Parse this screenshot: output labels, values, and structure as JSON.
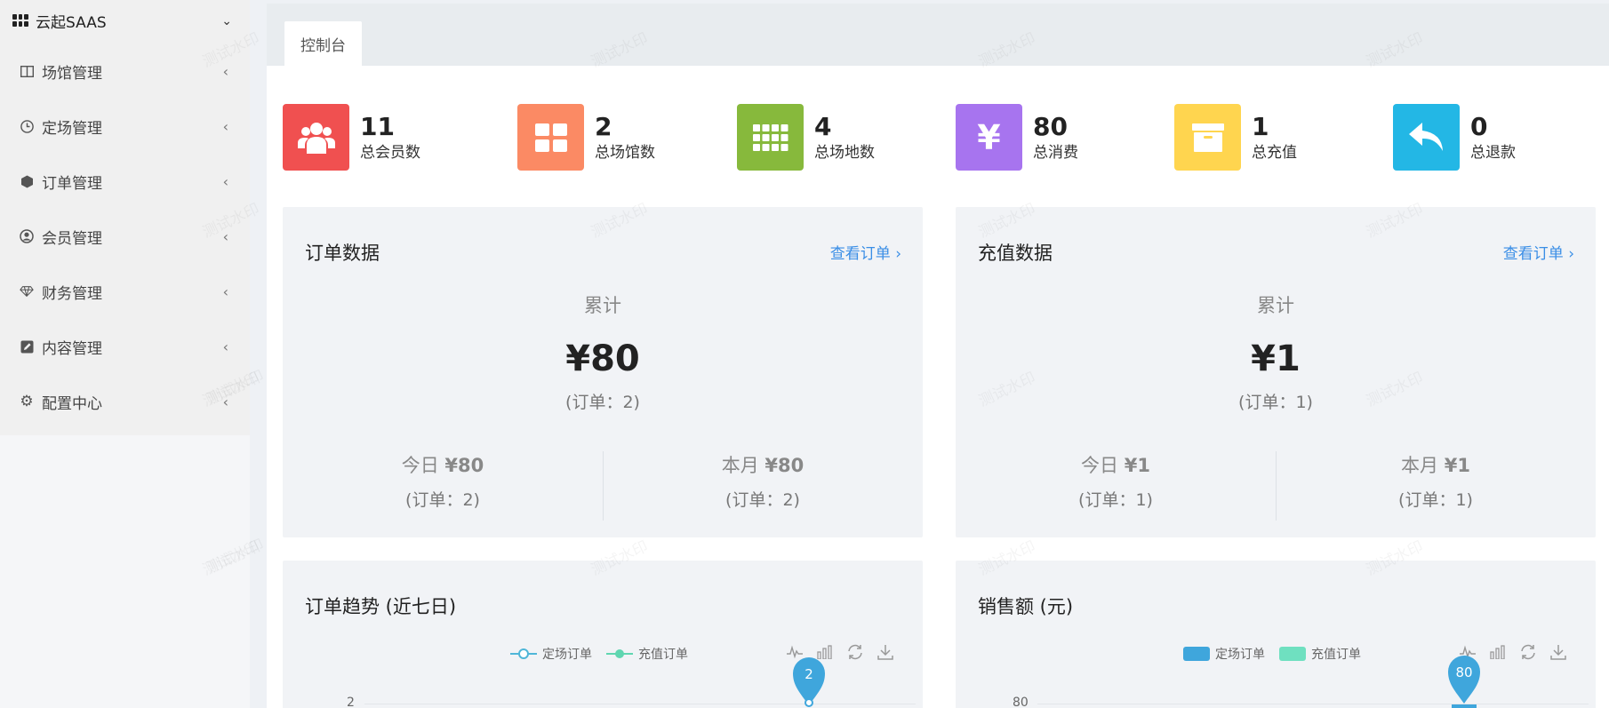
{
  "sidebar": {
    "brand": "云起SAAS",
    "items": [
      {
        "label": "场馆管理",
        "icon": "columns-icon"
      },
      {
        "label": "定场管理",
        "icon": "clock-icon"
      },
      {
        "label": "订单管理",
        "icon": "hexagon-icon"
      },
      {
        "label": "会员管理",
        "icon": "user-circle-icon"
      },
      {
        "label": "财务管理",
        "icon": "diamond-icon"
      },
      {
        "label": "内容管理",
        "icon": "edit-icon"
      },
      {
        "label": "配置中心",
        "icon": "gear-icon"
      }
    ]
  },
  "tabs": {
    "active": "控制台"
  },
  "stats": [
    {
      "value": "11",
      "label": "总会员数",
      "color": "#f05050",
      "icon": "users-icon"
    },
    {
      "value": "2",
      "label": "总场馆数",
      "color": "#fb8a64",
      "icon": "grid-2x2-icon"
    },
    {
      "value": "4",
      "label": "总场地数",
      "color": "#87b93c",
      "icon": "grid-3x3-icon"
    },
    {
      "value": "80",
      "label": "总消费",
      "color": "#a774ef",
      "icon": "yen-icon"
    },
    {
      "value": "1",
      "label": "总充值",
      "color": "#ffd54f",
      "icon": "archive-icon"
    },
    {
      "value": "0",
      "label": "总退款",
      "color": "#23b7e5",
      "icon": "reply-icon"
    }
  ],
  "order_card": {
    "title": "订单数据",
    "link": "查看订单",
    "total_label": "累计",
    "total_value": "¥80",
    "total_count": "(订单：2)",
    "today_label": "今日",
    "today_value": "¥80",
    "today_count": "(订单：2)",
    "month_label": "本月",
    "month_value": "¥80",
    "month_count": "(订单：2)"
  },
  "recharge_card": {
    "title": "充值数据",
    "link": "查看订单",
    "total_label": "累计",
    "total_value": "¥1",
    "total_count": "(订单：1)",
    "today_label": "今日",
    "today_value": "¥1",
    "today_count": "(订单：1)",
    "month_label": "本月",
    "month_value": "¥1",
    "month_count": "(订单：1)"
  },
  "trend_chart": {
    "title": "订单趋势 (近七日)",
    "legend": [
      "定场订单",
      "充值订单"
    ],
    "y_tick": "2",
    "marker_value": "2",
    "colors": {
      "series1": "#4fb6d8",
      "series2": "#5fd6b0"
    }
  },
  "sales_chart": {
    "title": "销售额 (元)",
    "legend": [
      "定场订单",
      "充值订单"
    ],
    "y_tick": "80",
    "marker_value": "80",
    "colors": {
      "series1": "#3fa6dc",
      "series2": "#6fe0c0"
    }
  },
  "watermark": "测试水印"
}
